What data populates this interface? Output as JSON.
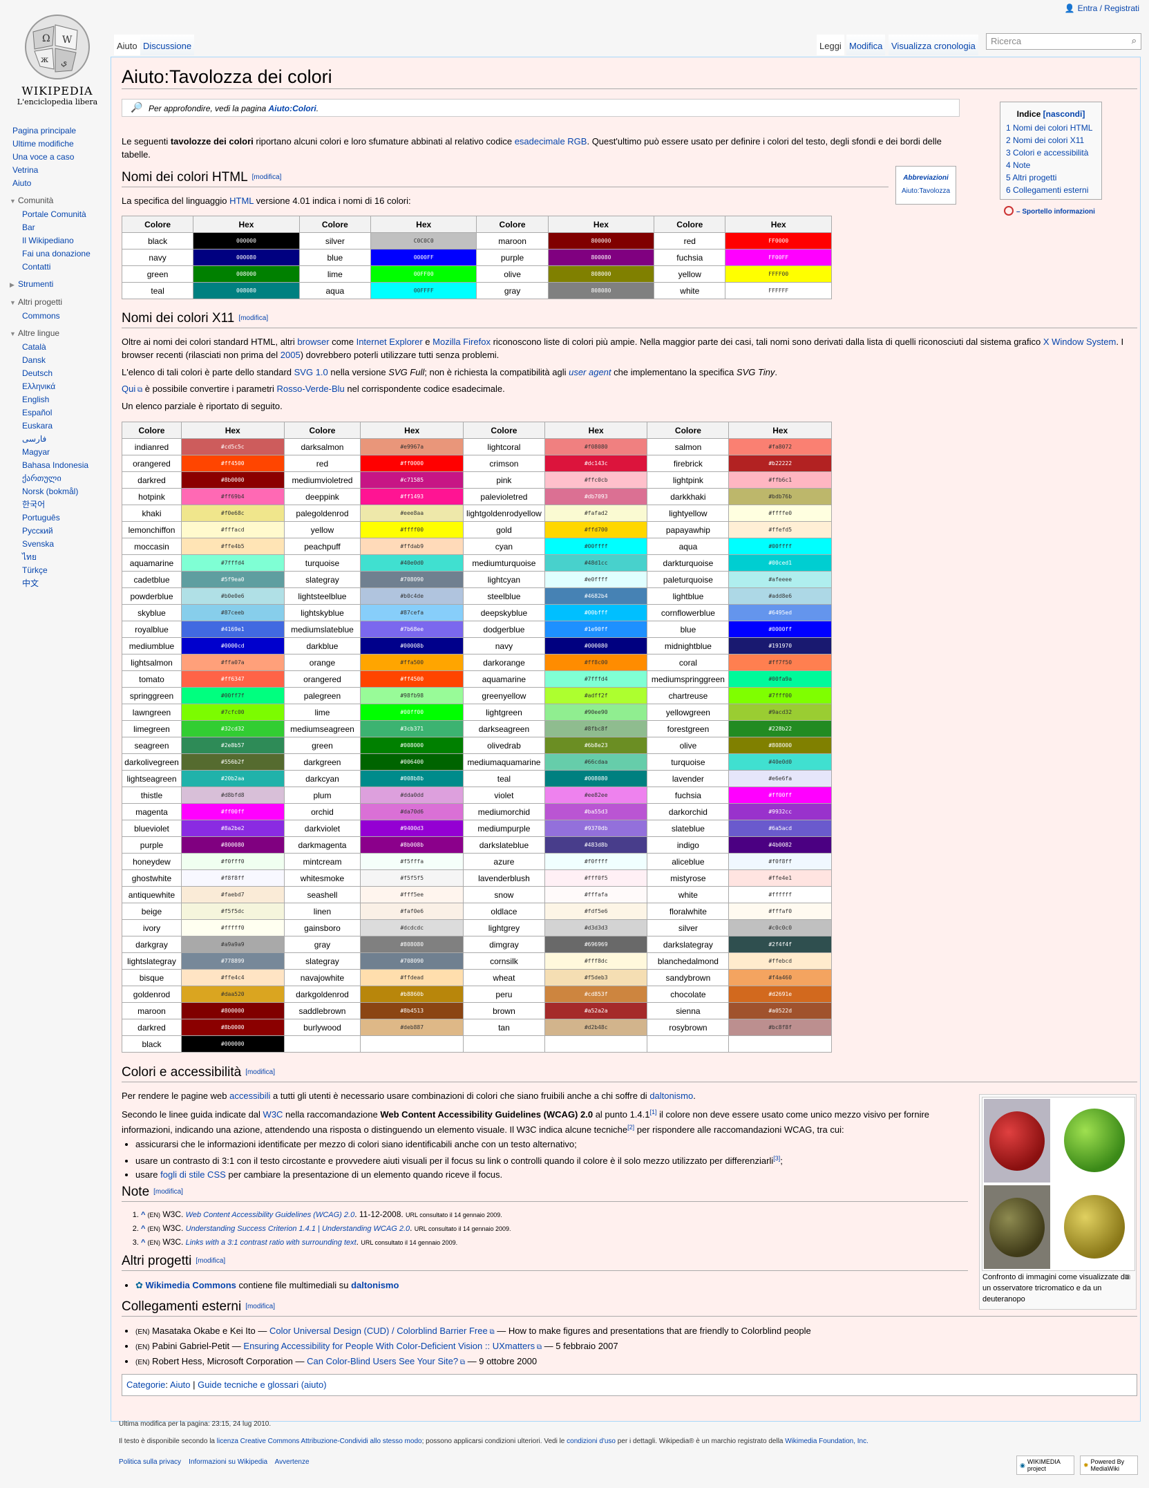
{
  "header": {
    "login": "Entra / Registrati",
    "search_placeholder": "Ricerca",
    "tabs_left": [
      "Aiuto",
      "Discussione"
    ],
    "tabs_right": [
      "Leggi",
      "Modifica",
      "Visualizza cronologia"
    ]
  },
  "logo": {
    "name": "WIKIPEDIA",
    "tagline": "L'enciclopedia libera"
  },
  "sidebar": {
    "main": [
      "Pagina principale",
      "Ultime modifiche",
      "Una voce a caso",
      "Vetrina",
      "Aiuto"
    ],
    "community_title": "Comunità",
    "community": [
      "Portale Comunità",
      "Bar",
      "Il Wikipediano",
      "Fai una donazione",
      "Contatti"
    ],
    "tools": "Strumenti",
    "projects_title": "Altri progetti",
    "projects": [
      "Commons"
    ],
    "languages_title": "Altre lingue",
    "languages": [
      "Català",
      "Dansk",
      "Deutsch",
      "Ελληνικά",
      "English",
      "Español",
      "Euskara",
      "فارسی",
      "Magyar",
      "Bahasa Indonesia",
      "ქართული",
      "Norsk (bokmål)",
      "한국어",
      "Português",
      "Русский",
      "Svenska",
      "ไทย",
      "Türkçe",
      "中文"
    ]
  },
  "page": {
    "title": "Aiuto:Tavolozza dei colori",
    "note_pre": "Per approfondire, vedi la pagina ",
    "note_link": "Aiuto:Colori",
    "note_post": ".",
    "intro_a": "Le seguenti ",
    "intro_b": "tavolozze dei colori",
    "intro_c": " riportano alcuni colori e loro sfumature abbinati al relativo codice ",
    "intro_link": "esadecimale RGB",
    "intro_d": ". Quest'ultimo può essere usato per definire i colori del testo, degli sfondi e dei bordi delle",
    "intro_e": "tabelle.",
    "edit": "[modifica]",
    "h_html": "Nomi dei colori HTML",
    "html_p_a": "La specifica del linguaggio ",
    "html_p_link": "HTML",
    "html_p_b": " versione 4.01 indica i nomi di 16 colori:",
    "h_x11": "Nomi dei colori X11",
    "x11_p1_a": "Oltre ai nomi dei colori standard HTML, altri ",
    "x11_l1": "browser",
    "x11_p1_b": " come ",
    "x11_l2": "Internet Explorer",
    "x11_p1_c": " e ",
    "x11_l3": "Mozilla Firefox",
    "x11_p1_d": " riconoscono liste di colori più ampie. Nella maggior parte dei casi, tali nomi sono derivati dalla lista di quelli riconosciuti dal sistema grafico ",
    "x11_l4": "X Window System",
    "x11_p1_e": ". I",
    "x11_p1_f": "browser recenti (rilasciati non prima del ",
    "x11_l5": "2005",
    "x11_p1_g": ") dovrebbero poterli utilizzare tutti senza problemi.",
    "x11_p2_a": "L'elenco di tali colori è parte dello standard ",
    "x11_l6": "SVG 1.0",
    "x11_p2_b": " nella versione ",
    "x11_p2_c": "SVG Full",
    "x11_p2_d": "; non è richiesta la compatibilità agli ",
    "x11_l7": "user agent",
    "x11_p2_e": " che implementano la specifica ",
    "x11_p2_f": "SVG Tiny",
    ".x": "",
    "x11_p3_a": "Qui",
    "x11_p3_b": " è possibile convertire i parametri ",
    "x11_l8": "Rosso-Verde-Blu",
    "x11_p3_c": " nel corrispondente codice esadecimale.",
    "x11_p4": "Un elenco parziale è riportato di seguito.",
    "h_acc": "Colori e accessibilità",
    "acc_p1_a": "Per rendere le pagine web ",
    "acc_l1": "accessibili",
    "acc_p1_b": " a tutti gli utenti è necessario usare combinazioni di colori che siano fruibili anche a chi soffre di ",
    "acc_l2": "daltonismo",
    "acc_p1_c": ".",
    "acc_p2_a": "Secondo le linee guida indicate dal ",
    "acc_l3": "W3C",
    "acc_p2_b": " nella raccomandazione ",
    "acc_p2_c": "Web Content Accessibility Guidelines (WCAG) 2.0",
    "acc_p2_d": " al punto 1.4.1",
    "acc_p2_e": " il colore non deve essere usato come unico mezzo visivo per fornire",
    "acc_p2_f": "informazioni, indicando una azione, attendendo una risposta o distinguendo un elemento visuale. Il W3C indica alcune tecniche",
    "acc_p2_g": " per rispondere alle raccomandazioni WCAG, tra cui:",
    "acc_b1": "assicurarsi che le informazioni identificate per mezzo di colori siano identificabili anche con un testo alternativo;",
    "acc_b2": "usare un contrasto di 3:1 con il testo circostante e provvedere aiuti visuali per il focus su link o controlli quando il colore è il solo mezzo utilizzato per differenziarli",
    "acc_b3_a": "usare ",
    "acc_b3_l": "fogli di stile CSS",
    "acc_b3_b": " per cambiare la presentazione di un elemento quando riceve il focus.",
    "h_note": "Note",
    "notes": [
      {
        "pre": "^ ",
        "lang": "(EN)",
        "a": " W3C. ",
        "link": "Web Content Accessibility Guidelines (WCAG) 2.0",
        "b": ". 11-12-2008. ",
        "c": "URL consultato il 14 gennaio 2009."
      },
      {
        "pre": "^ ",
        "lang": "(EN)",
        "a": " W3C. ",
        "link": "Understanding Success Criterion 1.4.1 | Understanding WCAG 2.0",
        "b": ". ",
        "c": "URL consultato il 14 gennaio 2009."
      },
      {
        "pre": "^ ",
        "lang": "(EN)",
        "a": " W3C. ",
        "link": "Links with a 3:1 contrast ratio with surrounding text",
        "b": ". ",
        "c": "URL consultato il 14 gennaio 2009."
      }
    ],
    "h_other": "Altri progetti",
    "other_l": "Wikimedia Commons",
    "other_b": " contiene file multimediali su ",
    "other_l2": "daltonismo",
    "h_ext": "Collegamenti esterni",
    "ext": [
      {
        "lang": "(EN)",
        "a": " Masataka Okabe e Kei Ito — ",
        "link": "Color Universal Design (CUD) / Colorblind Barrier Free",
        "b": " — How to make figures and presentations that are friendly to Colorblind people"
      },
      {
        "lang": "(EN)",
        "a": " Pabini Gabriel-Petit — ",
        "link": "Ensuring Accessibility for People With Color-Deficient Vision :: UXmatters",
        "b": " — 5 febbraio 2007"
      },
      {
        "lang": "(EN)",
        "a": " Robert Hess, Microsoft Corporation — ",
        "link": "Can Color-Blind Users See Your Site?",
        "b": " — 9 ottobre 2000"
      }
    ],
    "cat_label": "Categorie",
    "cat_a": "Aiuto",
    "cat_b": "Guide tecniche e glossari (aiuto)",
    "caption": "Confronto di immagini come visualizzate da un osservatore tricromatico e da un deuteranopo"
  },
  "toc": {
    "title": "Indice",
    "toggle": "[nascondi]",
    "items": [
      "1 Nomi dei colori HTML",
      "2 Nomi dei colori X11",
      "3 Colori e accessibilità",
      "4 Note",
      "5 Altri progetti",
      "6 Collegamenti esterni"
    ]
  },
  "help": "Sportello informazioni",
  "abbr": {
    "title": "Abbreviazioni",
    "link": "Aiuto:Tavolozza"
  },
  "html_colors": {
    "headers": [
      "Colore",
      "Hex",
      "Colore",
      "Hex",
      "Colore",
      "Hex",
      "Colore",
      "Hex"
    ],
    "rows": [
      [
        [
          "black",
          "000000"
        ],
        [
          "silver",
          "C0C0C0"
        ],
        [
          "maroon",
          "800000"
        ],
        [
          "red",
          "FF0000"
        ]
      ],
      [
        [
          "navy",
          "000080"
        ],
        [
          "blue",
          "0000FF"
        ],
        [
          "purple",
          "800080"
        ],
        [
          "fuchsia",
          "FF00FF"
        ]
      ],
      [
        [
          "green",
          "008000"
        ],
        [
          "lime",
          "00FF00"
        ],
        [
          "olive",
          "808000"
        ],
        [
          "yellow",
          "FFFF00"
        ]
      ],
      [
        [
          "teal",
          "008080"
        ],
        [
          "aqua",
          "00FFFF"
        ],
        [
          "gray",
          "808080"
        ],
        [
          "white",
          "FFFFFF"
        ]
      ]
    ]
  },
  "x11_colors": {
    "headers": [
      "Colore",
      "Hex",
      "Colore",
      "Hex",
      "Colore",
      "Hex",
      "Colore",
      "Hex"
    ],
    "rows": [
      [
        [
          "indianred",
          "#cd5c5c"
        ],
        [
          "darksalmon",
          "#e9967a"
        ],
        [
          "lightcoral",
          "#f08080"
        ],
        [
          "salmon",
          "#fa8072"
        ]
      ],
      [
        [
          "orangered",
          "#ff4500"
        ],
        [
          "red",
          "#ff0000"
        ],
        [
          "crimson",
          "#dc143c"
        ],
        [
          "firebrick",
          "#b22222"
        ]
      ],
      [
        [
          "darkred",
          "#8b0000"
        ],
        [
          "mediumvioletred",
          "#c71585"
        ],
        [
          "pink",
          "#ffc0cb"
        ],
        [
          "lightpink",
          "#ffb6c1"
        ]
      ],
      [
        [
          "hotpink",
          "#ff69b4"
        ],
        [
          "deeppink",
          "#ff1493"
        ],
        [
          "palevioletred",
          "#db7093"
        ],
        [
          "darkkhaki",
          "#bdb76b"
        ]
      ],
      [
        [
          "khaki",
          "#f0e68c"
        ],
        [
          "palegoldenrod",
          "#eee8aa"
        ],
        [
          "lightgoldenrodyellow",
          "#fafad2"
        ],
        [
          "lightyellow",
          "#ffffe0"
        ]
      ],
      [
        [
          "lemonchiffon",
          "#fffacd"
        ],
        [
          "yellow",
          "#ffff00"
        ],
        [
          "gold",
          "#ffd700"
        ],
        [
          "papayawhip",
          "#ffefd5"
        ]
      ],
      [
        [
          "moccasin",
          "#ffe4b5"
        ],
        [
          "peachpuff",
          "#ffdab9"
        ],
        [
          "cyan",
          "#00ffff"
        ],
        [
          "aqua",
          "#00ffff"
        ]
      ],
      [
        [
          "aquamarine",
          "#7fffd4"
        ],
        [
          "turquoise",
          "#40e0d0"
        ],
        [
          "mediumturquoise",
          "#48d1cc"
        ],
        [
          "darkturquoise",
          "#00ced1"
        ]
      ],
      [
        [
          "cadetblue",
          "#5f9ea0"
        ],
        [
          "slategray",
          "#708090"
        ],
        [
          "lightcyan",
          "#e0ffff"
        ],
        [
          "paleturquoise",
          "#afeeee"
        ]
      ],
      [
        [
          "powderblue",
          "#b0e0e6"
        ],
        [
          "lightsteelblue",
          "#b0c4de"
        ],
        [
          "steelblue",
          "#4682b4"
        ],
        [
          "lightblue",
          "#add8e6"
        ]
      ],
      [
        [
          "skyblue",
          "#87ceeb"
        ],
        [
          "lightskyblue",
          "#87cefa"
        ],
        [
          "deepskyblue",
          "#00bfff"
        ],
        [
          "cornflowerblue",
          "#6495ed"
        ]
      ],
      [
        [
          "royalblue",
          "#4169e1"
        ],
        [
          "mediumslateblue",
          "#7b68ee"
        ],
        [
          "dodgerblue",
          "#1e90ff"
        ],
        [
          "blue",
          "#0000ff"
        ]
      ],
      [
        [
          "mediumblue",
          "#0000cd"
        ],
        [
          "darkblue",
          "#00008b"
        ],
        [
          "navy",
          "#000080"
        ],
        [
          "midnightblue",
          "#191970"
        ]
      ],
      [
        [
          "lightsalmon",
          "#ffa07a"
        ],
        [
          "orange",
          "#ffa500"
        ],
        [
          "darkorange",
          "#ff8c00"
        ],
        [
          "coral",
          "#ff7f50"
        ]
      ],
      [
        [
          "tomato",
          "#ff6347"
        ],
        [
          "orangered",
          "#ff4500"
        ],
        [
          "aquamarine",
          "#7fffd4"
        ],
        [
          "mediumspringgreen",
          "#00fa9a"
        ]
      ],
      [
        [
          "springgreen",
          "#00ff7f"
        ],
        [
          "palegreen",
          "#98fb98"
        ],
        [
          "greenyellow",
          "#adff2f"
        ],
        [
          "chartreuse",
          "#7fff00"
        ]
      ],
      [
        [
          "lawngreen",
          "#7cfc00"
        ],
        [
          "lime",
          "#00ff00"
        ],
        [
          "lightgreen",
          "#90ee90"
        ],
        [
          "yellowgreen",
          "#9acd32"
        ]
      ],
      [
        [
          "limegreen",
          "#32cd32"
        ],
        [
          "mediumseagreen",
          "#3cb371"
        ],
        [
          "darkseagreen",
          "#8fbc8f"
        ],
        [
          "forestgreen",
          "#228b22"
        ]
      ],
      [
        [
          "seagreen",
          "#2e8b57"
        ],
        [
          "green",
          "#008000"
        ],
        [
          "olivedrab",
          "#6b8e23"
        ],
        [
          "olive",
          "#808000"
        ]
      ],
      [
        [
          "darkolivegreen",
          "#556b2f"
        ],
        [
          "darkgreen",
          "#006400"
        ],
        [
          "mediumaquamarine",
          "#66cdaa"
        ],
        [
          "turquoise",
          "#40e0d0"
        ]
      ],
      [
        [
          "lightseagreen",
          "#20b2aa"
        ],
        [
          "darkcyan",
          "#008b8b"
        ],
        [
          "teal",
          "#008080"
        ],
        [
          "lavender",
          "#e6e6fa"
        ]
      ],
      [
        [
          "thistle",
          "#d8bfd8"
        ],
        [
          "plum",
          "#dda0dd"
        ],
        [
          "violet",
          "#ee82ee"
        ],
        [
          "fuchsia",
          "#ff00ff"
        ]
      ],
      [
        [
          "magenta",
          "#ff00ff"
        ],
        [
          "orchid",
          "#da70d6"
        ],
        [
          "mediumorchid",
          "#ba55d3"
        ],
        [
          "darkorchid",
          "#9932cc"
        ]
      ],
      [
        [
          "blueviolet",
          "#8a2be2"
        ],
        [
          "darkviolet",
          "#9400d3"
        ],
        [
          "mediumpurple",
          "#9370db"
        ],
        [
          "slateblue",
          "#6a5acd"
        ]
      ],
      [
        [
          "purple",
          "#800080"
        ],
        [
          "darkmagenta",
          "#8b008b"
        ],
        [
          "darkslateblue",
          "#483d8b"
        ],
        [
          "indigo",
          "#4b0082"
        ]
      ],
      [
        [
          "honeydew",
          "#f0fff0"
        ],
        [
          "mintcream",
          "#f5fffa"
        ],
        [
          "azure",
          "#f0ffff"
        ],
        [
          "aliceblue",
          "#f0f8ff"
        ]
      ],
      [
        [
          "ghostwhite",
          "#f8f8ff"
        ],
        [
          "whitesmoke",
          "#f5f5f5"
        ],
        [
          "lavenderblush",
          "#fff0f5"
        ],
        [
          "mistyrose",
          "#ffe4e1"
        ]
      ],
      [
        [
          "antiquewhite",
          "#faebd7"
        ],
        [
          "seashell",
          "#fff5ee"
        ],
        [
          "snow",
          "#fffafa"
        ],
        [
          "white",
          "#ffffff"
        ]
      ],
      [
        [
          "beige",
          "#f5f5dc"
        ],
        [
          "linen",
          "#faf0e6"
        ],
        [
          "oldlace",
          "#fdf5e6"
        ],
        [
          "floralwhite",
          "#fffaf0"
        ]
      ],
      [
        [
          "ivory",
          "#fffff0"
        ],
        [
          "gainsboro",
          "#dcdcdc"
        ],
        [
          "lightgrey",
          "#d3d3d3"
        ],
        [
          "silver",
          "#c0c0c0"
        ]
      ],
      [
        [
          "darkgray",
          "#a9a9a9"
        ],
        [
          "gray",
          "#808080"
        ],
        [
          "dimgray",
          "#696969"
        ],
        [
          "darkslategray",
          "#2f4f4f"
        ]
      ],
      [
        [
          "lightslategray",
          "#778899"
        ],
        [
          "slategray",
          "#708090"
        ],
        [
          "cornsilk",
          "#fff8dc"
        ],
        [
          "blanchedalmond",
          "#ffebcd"
        ]
      ],
      [
        [
          "bisque",
          "#ffe4c4"
        ],
        [
          "navajowhite",
          "#ffdead"
        ],
        [
          "wheat",
          "#f5deb3"
        ],
        [
          "sandybrown",
          "#f4a460"
        ]
      ],
      [
        [
          "goldenrod",
          "#daa520"
        ],
        [
          "darkgoldenrod",
          "#b8860b"
        ],
        [
          "peru",
          "#cd853f"
        ],
        [
          "chocolate",
          "#d2691e"
        ]
      ],
      [
        [
          "maroon",
          "#800000"
        ],
        [
          "saddlebrown",
          "#8b4513"
        ],
        [
          "brown",
          "#a52a2a"
        ],
        [
          "sienna",
          "#a0522d"
        ]
      ],
      [
        [
          "darkred",
          "#8b0000"
        ],
        [
          "burlywood",
          "#deb887"
        ],
        [
          "tan",
          "#d2b48c"
        ],
        [
          "rosybrown",
          "#bc8f8f"
        ]
      ],
      [
        [
          "black",
          "#000000"
        ],
        null,
        null,
        null
      ]
    ]
  },
  "footer": {
    "modified": "Ultima modifica per la pagina: 23:15, 24 lug 2010.",
    "lic_a": "Il testo è disponibile secondo la ",
    "lic_l1": "licenza Creative Commons Attribuzione-Condividi allo stesso modo",
    "lic_b": "; possono applicarsi condizioni ulteriori. Vedi le ",
    "lic_l2": "condizioni d'uso",
    "lic_c": " per i dettagli. Wikipedia® è un marchio registrato della ",
    "lic_l3": "Wikimedia Foundation, Inc.",
    "links": [
      "Politica sulla privacy",
      "Informazioni su Wikipedia",
      "Avvertenze"
    ],
    "badge1": "WIKIMEDIA project",
    "badge2": "Powered By MediaWiki"
  }
}
